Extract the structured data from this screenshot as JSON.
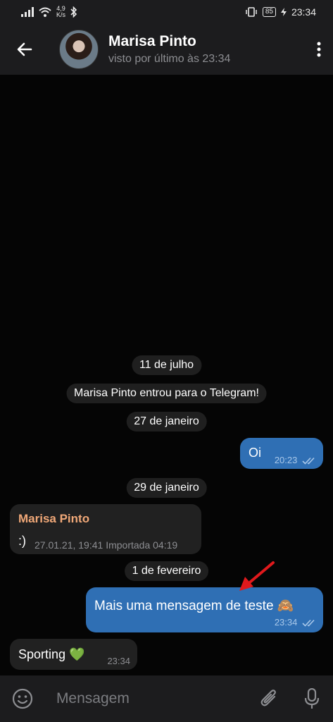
{
  "status_bar": {
    "speed_value": "4,9",
    "speed_unit": "K/s",
    "battery": "85",
    "time": "23:34"
  },
  "header": {
    "contact_name": "Marisa Pinto",
    "last_seen": "visto por último às 23:34"
  },
  "messages": [
    {
      "type": "date",
      "text": "11 de julho"
    },
    {
      "type": "service",
      "text": "Marisa Pinto entrou para o Telegram!"
    },
    {
      "type": "date",
      "text": "27 de janeiro"
    },
    {
      "type": "outgoing",
      "text": "Oi",
      "time": "20:23"
    },
    {
      "type": "date",
      "text": "29 de janeiro"
    },
    {
      "type": "incoming",
      "sender": "Marisa Pinto",
      "text": ":)",
      "meta": "27.01.21, 19:41 Importada 04:19"
    },
    {
      "type": "date",
      "text": "1 de fevereiro"
    },
    {
      "type": "outgoing",
      "text": "Mais uma mensagem de teste 🙈",
      "time": "23:34"
    },
    {
      "type": "incoming",
      "text": "Sporting 💚",
      "time": "23:34"
    }
  ],
  "input": {
    "placeholder": "Mensagem"
  },
  "icons": [
    "back-arrow-icon",
    "more-vertical-icon",
    "emoji-icon",
    "attach-icon",
    "microphone-icon",
    "double-check-icon",
    "red-arrow-annotation"
  ],
  "colors": {
    "outgoing_bubble": "#2f6fb4",
    "incoming_bubble": "#212121",
    "sender_name": "#f0a878",
    "annotation": "#e0191c"
  }
}
